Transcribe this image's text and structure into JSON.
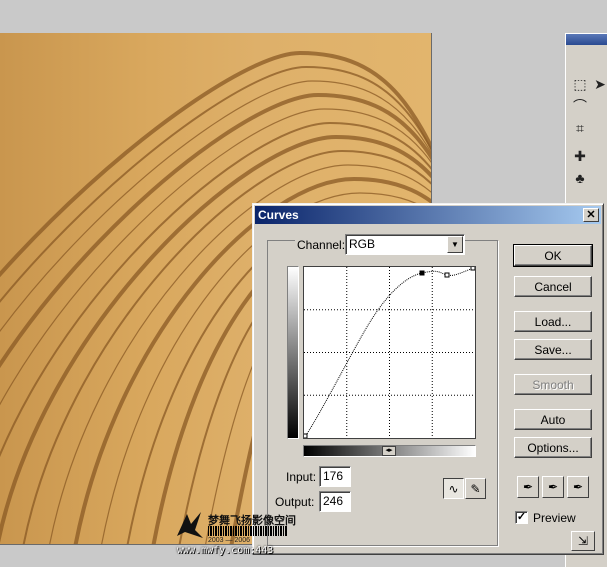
{
  "dialog": {
    "title": "Curves",
    "channel_label": "Channel:",
    "channel_value": "RGB",
    "input_label": "Input:",
    "input_value": "176",
    "output_label": "Output:",
    "output_value": "246",
    "buttons": {
      "ok": "OK",
      "cancel": "Cancel",
      "load": "Load...",
      "save": "Save...",
      "smooth": "Smooth",
      "auto": "Auto",
      "options": "Options..."
    },
    "preview_label": "Preview",
    "preview_checked": true
  },
  "watermark": {
    "line1": "梦舞飞扬影像空间",
    "line2": "2003 — 2006",
    "line3": "www.mwfy.com:443"
  },
  "icons": [
    "close-icon",
    "dropdown-arrow-icon",
    "curve-tool-icon",
    "pencil-tool-icon",
    "black-eyedropper-icon",
    "gray-eyedropper-icon",
    "white-eyedropper-icon",
    "expand-icon",
    "marquee-icon",
    "lasso-icon",
    "crop-icon",
    "healing-icon",
    "stamp-icon",
    "move-icon"
  ]
}
